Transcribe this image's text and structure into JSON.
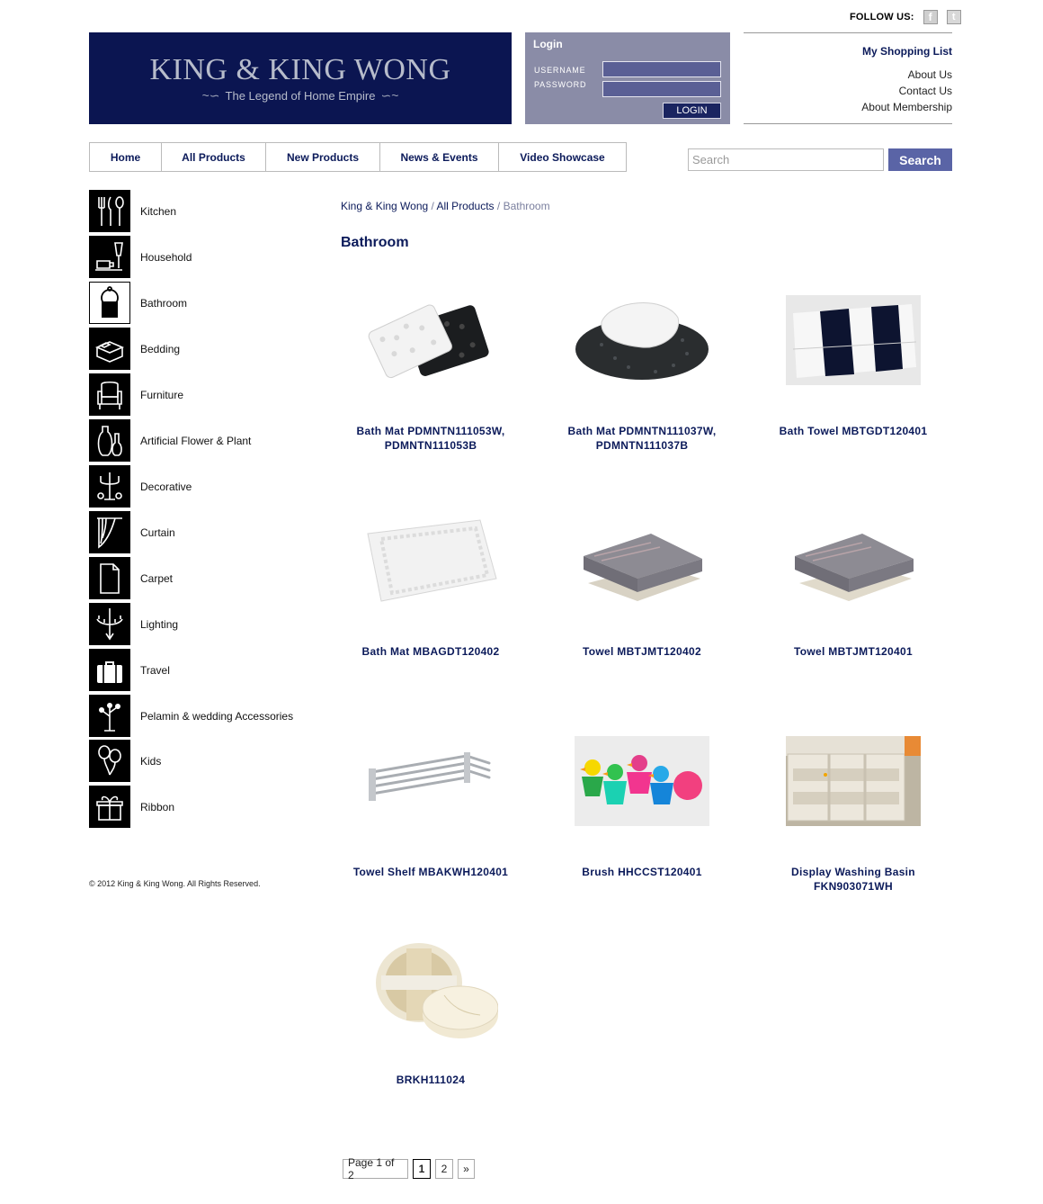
{
  "header": {
    "follow_label": "FOLLOW US:",
    "facebook_icon": "facebook-icon",
    "twitter_icon": "twitter-icon",
    "brand": "KING & KING WONG",
    "tagline": "The Legend of Home Empire"
  },
  "login": {
    "title": "Login",
    "username_label": "USERNAME",
    "password_label": "PASSWORD",
    "username_value": "",
    "password_value": "",
    "button": "LOGIN"
  },
  "right_links": {
    "shopping_list": "My Shopping List",
    "about": "About Us",
    "contact": "Contact Us",
    "membership": "About Membership"
  },
  "nav": {
    "items": [
      "Home",
      "All Products",
      "New Products",
      "News & Events",
      "Video Showcase"
    ]
  },
  "search": {
    "placeholder": "Search",
    "value": "",
    "button": "Search"
  },
  "sidebar": {
    "categories": [
      {
        "label": "Kitchen",
        "icon": "cutlery-icon"
      },
      {
        "label": "Household",
        "icon": "cup-glass-icon"
      },
      {
        "label": "Bathroom",
        "icon": "towel-ring-icon",
        "selected": true
      },
      {
        "label": "Bedding",
        "icon": "bed-icon"
      },
      {
        "label": "Furniture",
        "icon": "armchair-icon"
      },
      {
        "label": "Artificial Flower & Plant",
        "icon": "vase-icon"
      },
      {
        "label": "Decorative",
        "icon": "candelabra-icon"
      },
      {
        "label": "Curtain",
        "icon": "curtain-icon"
      },
      {
        "label": "Carpet",
        "icon": "carpet-icon"
      },
      {
        "label": "Lighting",
        "icon": "chandelier-icon"
      },
      {
        "label": "Travel",
        "icon": "suitcase-icon"
      },
      {
        "label": "Pelamin & wedding Accessories",
        "icon": "flower-stand-icon"
      },
      {
        "label": "Kids",
        "icon": "balloons-icon"
      },
      {
        "label": "Ribbon",
        "icon": "gift-ribbon-icon"
      }
    ],
    "copyright": "© 2012 King & King Wong. All Rights Reserved."
  },
  "breadcrumb": {
    "home": "King & King Wong",
    "sep": " / ",
    "all": "All Products",
    "current": "Bathroom"
  },
  "page_title": "Bathroom",
  "products": [
    {
      "name": "Bath Mat PDMNTN111053W, PDMNTN111053B",
      "image": "bath-mat-black-white"
    },
    {
      "name": "Bath Mat PDMNTN111037W, PDMNTN111037B",
      "image": "bath-mat-oval"
    },
    {
      "name": "Bath Towel MBTGDT120401",
      "image": "bath-towel-striped"
    },
    {
      "name": "Bath Mat MBAGDT120402",
      "image": "bath-mat-white"
    },
    {
      "name": "Towel MBTJMT120402",
      "image": "towel-grey-stack"
    },
    {
      "name": "Towel MBTJMT120401",
      "image": "towel-grey-stack"
    },
    {
      "name": "Towel Shelf MBAKWH120401",
      "image": "towel-shelf"
    },
    {
      "name": "Brush HHCCST120401",
      "image": "duck-brushes"
    },
    {
      "name": "Display Washing Basin FKN903071WH",
      "image": "washing-basin-cabinet"
    },
    {
      "name": "BRKH111024",
      "image": "bath-sponge"
    }
  ],
  "pagination": {
    "summary": "Page 1 of 2",
    "pages": [
      "1",
      "2"
    ],
    "next": "»"
  }
}
